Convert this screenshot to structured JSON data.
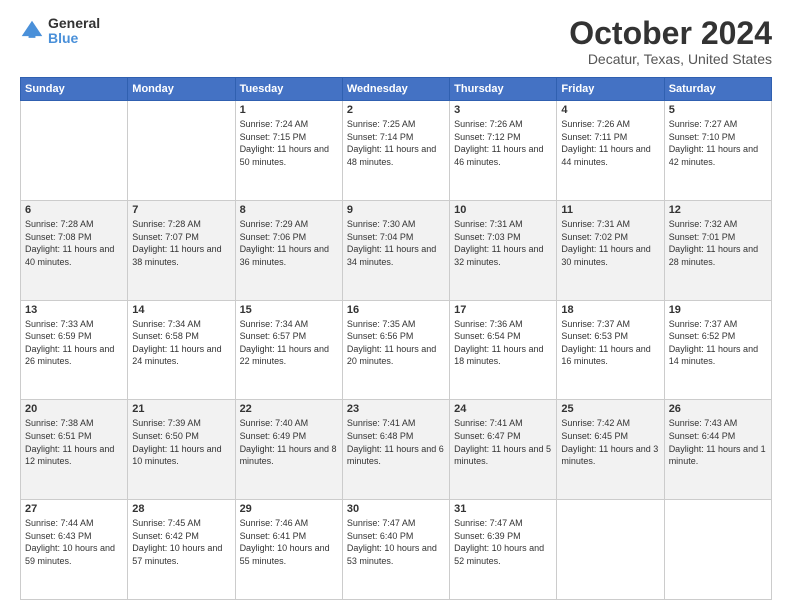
{
  "logo": {
    "general": "General",
    "blue": "Blue"
  },
  "title": "October 2024",
  "location": "Decatur, Texas, United States",
  "headers": [
    "Sunday",
    "Monday",
    "Tuesday",
    "Wednesday",
    "Thursday",
    "Friday",
    "Saturday"
  ],
  "weeks": [
    [
      {
        "day": "",
        "info": ""
      },
      {
        "day": "",
        "info": ""
      },
      {
        "day": "1",
        "info": "Sunrise: 7:24 AM\nSunset: 7:15 PM\nDaylight: 11 hours and 50 minutes."
      },
      {
        "day": "2",
        "info": "Sunrise: 7:25 AM\nSunset: 7:14 PM\nDaylight: 11 hours and 48 minutes."
      },
      {
        "day": "3",
        "info": "Sunrise: 7:26 AM\nSunset: 7:12 PM\nDaylight: 11 hours and 46 minutes."
      },
      {
        "day": "4",
        "info": "Sunrise: 7:26 AM\nSunset: 7:11 PM\nDaylight: 11 hours and 44 minutes."
      },
      {
        "day": "5",
        "info": "Sunrise: 7:27 AM\nSunset: 7:10 PM\nDaylight: 11 hours and 42 minutes."
      }
    ],
    [
      {
        "day": "6",
        "info": "Sunrise: 7:28 AM\nSunset: 7:08 PM\nDaylight: 11 hours and 40 minutes."
      },
      {
        "day": "7",
        "info": "Sunrise: 7:28 AM\nSunset: 7:07 PM\nDaylight: 11 hours and 38 minutes."
      },
      {
        "day": "8",
        "info": "Sunrise: 7:29 AM\nSunset: 7:06 PM\nDaylight: 11 hours and 36 minutes."
      },
      {
        "day": "9",
        "info": "Sunrise: 7:30 AM\nSunset: 7:04 PM\nDaylight: 11 hours and 34 minutes."
      },
      {
        "day": "10",
        "info": "Sunrise: 7:31 AM\nSunset: 7:03 PM\nDaylight: 11 hours and 32 minutes."
      },
      {
        "day": "11",
        "info": "Sunrise: 7:31 AM\nSunset: 7:02 PM\nDaylight: 11 hours and 30 minutes."
      },
      {
        "day": "12",
        "info": "Sunrise: 7:32 AM\nSunset: 7:01 PM\nDaylight: 11 hours and 28 minutes."
      }
    ],
    [
      {
        "day": "13",
        "info": "Sunrise: 7:33 AM\nSunset: 6:59 PM\nDaylight: 11 hours and 26 minutes."
      },
      {
        "day": "14",
        "info": "Sunrise: 7:34 AM\nSunset: 6:58 PM\nDaylight: 11 hours and 24 minutes."
      },
      {
        "day": "15",
        "info": "Sunrise: 7:34 AM\nSunset: 6:57 PM\nDaylight: 11 hours and 22 minutes."
      },
      {
        "day": "16",
        "info": "Sunrise: 7:35 AM\nSunset: 6:56 PM\nDaylight: 11 hours and 20 minutes."
      },
      {
        "day": "17",
        "info": "Sunrise: 7:36 AM\nSunset: 6:54 PM\nDaylight: 11 hours and 18 minutes."
      },
      {
        "day": "18",
        "info": "Sunrise: 7:37 AM\nSunset: 6:53 PM\nDaylight: 11 hours and 16 minutes."
      },
      {
        "day": "19",
        "info": "Sunrise: 7:37 AM\nSunset: 6:52 PM\nDaylight: 11 hours and 14 minutes."
      }
    ],
    [
      {
        "day": "20",
        "info": "Sunrise: 7:38 AM\nSunset: 6:51 PM\nDaylight: 11 hours and 12 minutes."
      },
      {
        "day": "21",
        "info": "Sunrise: 7:39 AM\nSunset: 6:50 PM\nDaylight: 11 hours and 10 minutes."
      },
      {
        "day": "22",
        "info": "Sunrise: 7:40 AM\nSunset: 6:49 PM\nDaylight: 11 hours and 8 minutes."
      },
      {
        "day": "23",
        "info": "Sunrise: 7:41 AM\nSunset: 6:48 PM\nDaylight: 11 hours and 6 minutes."
      },
      {
        "day": "24",
        "info": "Sunrise: 7:41 AM\nSunset: 6:47 PM\nDaylight: 11 hours and 5 minutes."
      },
      {
        "day": "25",
        "info": "Sunrise: 7:42 AM\nSunset: 6:45 PM\nDaylight: 11 hours and 3 minutes."
      },
      {
        "day": "26",
        "info": "Sunrise: 7:43 AM\nSunset: 6:44 PM\nDaylight: 11 hours and 1 minute."
      }
    ],
    [
      {
        "day": "27",
        "info": "Sunrise: 7:44 AM\nSunset: 6:43 PM\nDaylight: 10 hours and 59 minutes."
      },
      {
        "day": "28",
        "info": "Sunrise: 7:45 AM\nSunset: 6:42 PM\nDaylight: 10 hours and 57 minutes."
      },
      {
        "day": "29",
        "info": "Sunrise: 7:46 AM\nSunset: 6:41 PM\nDaylight: 10 hours and 55 minutes."
      },
      {
        "day": "30",
        "info": "Sunrise: 7:47 AM\nSunset: 6:40 PM\nDaylight: 10 hours and 53 minutes."
      },
      {
        "day": "31",
        "info": "Sunrise: 7:47 AM\nSunset: 6:39 PM\nDaylight: 10 hours and 52 minutes."
      },
      {
        "day": "",
        "info": ""
      },
      {
        "day": "",
        "info": ""
      }
    ]
  ]
}
